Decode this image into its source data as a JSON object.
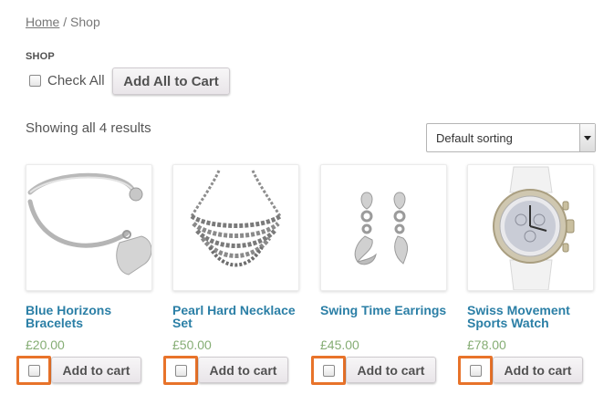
{
  "breadcrumb": {
    "home": "Home",
    "separator": " / ",
    "current": "Shop"
  },
  "shop": {
    "heading": "SHOP",
    "check_all_label": "Check All",
    "add_all_label": "Add All to Cart",
    "results_text": "Showing all 4 results",
    "sorting_selected": "Default sorting"
  },
  "colors": {
    "link": "#2b7fa6",
    "price": "#85ad74",
    "highlight": "#e8732a"
  },
  "products": [
    {
      "name": "Blue Horizons Bracelets",
      "price": "£20.00",
      "button": "Add to cart",
      "image": "bracelet-image"
    },
    {
      "name": "Pearl Hard Necklace Set",
      "price": "£50.00",
      "button": "Add to cart",
      "image": "necklace-image"
    },
    {
      "name": "Swing Time Earrings",
      "price": "£45.00",
      "button": "Add to cart",
      "image": "earrings-image"
    },
    {
      "name": "Swiss Movement Sports Watch",
      "price": "£78.00",
      "button": "Add to cart",
      "image": "watch-image"
    }
  ]
}
